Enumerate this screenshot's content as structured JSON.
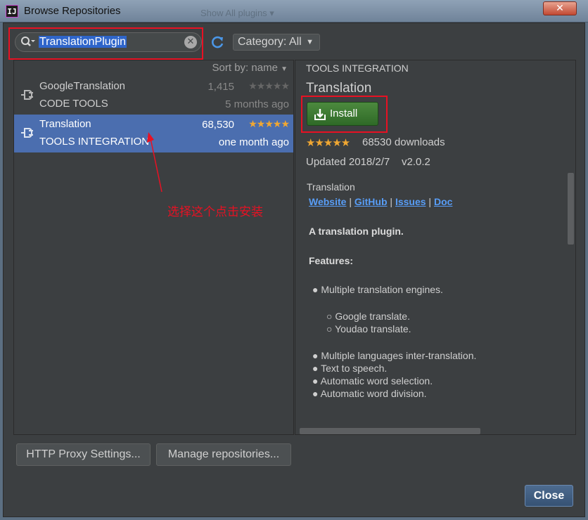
{
  "window": {
    "title": "Browse Repositories",
    "app_icon": "IJ",
    "close_glyph": "✕",
    "background_ghost": "Show   All plugins  ▾"
  },
  "search": {
    "value": "TranslationPlugin",
    "icon": "search-icon",
    "clear_glyph": "✕"
  },
  "category_select": {
    "label": "Category: All",
    "caret": "▼"
  },
  "list": {
    "sort_label": "Sort by: name",
    "sort_caret": "▼",
    "items": [
      {
        "name": "GoogleTranslation",
        "category": "CODE TOOLS",
        "downloads": "1,415",
        "rating": 0,
        "date": "5 months ago",
        "selected": false
      },
      {
        "name": "Translation",
        "category": "TOOLS INTEGRATION",
        "downloads": "68,530",
        "rating": 5,
        "date": "one month ago",
        "selected": true
      }
    ]
  },
  "annotation": {
    "text": "选择这个点击安装",
    "color": "#e81123"
  },
  "detail": {
    "category": "TOOLS INTEGRATION",
    "title": "Translation",
    "install_label": "Install",
    "rating": 5,
    "downloads": "68530 downloads",
    "updated": "Updated 2018/2/7",
    "version": "v2.0.2",
    "description_name": "Translation",
    "links": [
      "Website",
      "GitHub",
      "Issues",
      "Doc"
    ],
    "link_separator": "|",
    "tagline": "A translation plugin.",
    "features_heading": "Features:",
    "features": [
      {
        "bullet": "●",
        "text": "Multiple translation engines."
      },
      {
        "bullet": "○",
        "text": "Google translate."
      },
      {
        "bullet": "○",
        "text": "Youdao translate."
      },
      {
        "bullet": "●",
        "text": "Multiple languages inter-translation."
      },
      {
        "bullet": "●",
        "text": "Text to speech."
      },
      {
        "bullet": "●",
        "text": "Automatic word selection."
      },
      {
        "bullet": "●",
        "text": "Automatic word division."
      }
    ]
  },
  "footer": {
    "http_proxy_label": "HTTP Proxy Settings...",
    "manage_repos_label": "Manage repositories...",
    "close_label": "Close"
  },
  "colors": {
    "selection": "#4b6eaf",
    "install_green": "#3c7a32",
    "link_blue": "#589df6",
    "star": "#f0a732",
    "highlight_red": "#e81123"
  }
}
